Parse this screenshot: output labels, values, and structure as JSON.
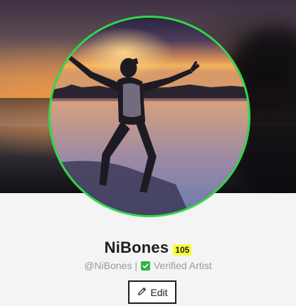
{
  "profile": {
    "name": "NiBones",
    "score": "105",
    "handle": "@NiBones |",
    "verified_label": "Verified Artist"
  },
  "actions": {
    "edit_label": "Edit"
  },
  "icons": {
    "verified": "checkbox-check-icon",
    "edit": "pencil-icon"
  },
  "colors": {
    "avatar_ring": "#33d84a",
    "score_badge": "#f6ff3a",
    "verified_check": "#2fb24a"
  }
}
